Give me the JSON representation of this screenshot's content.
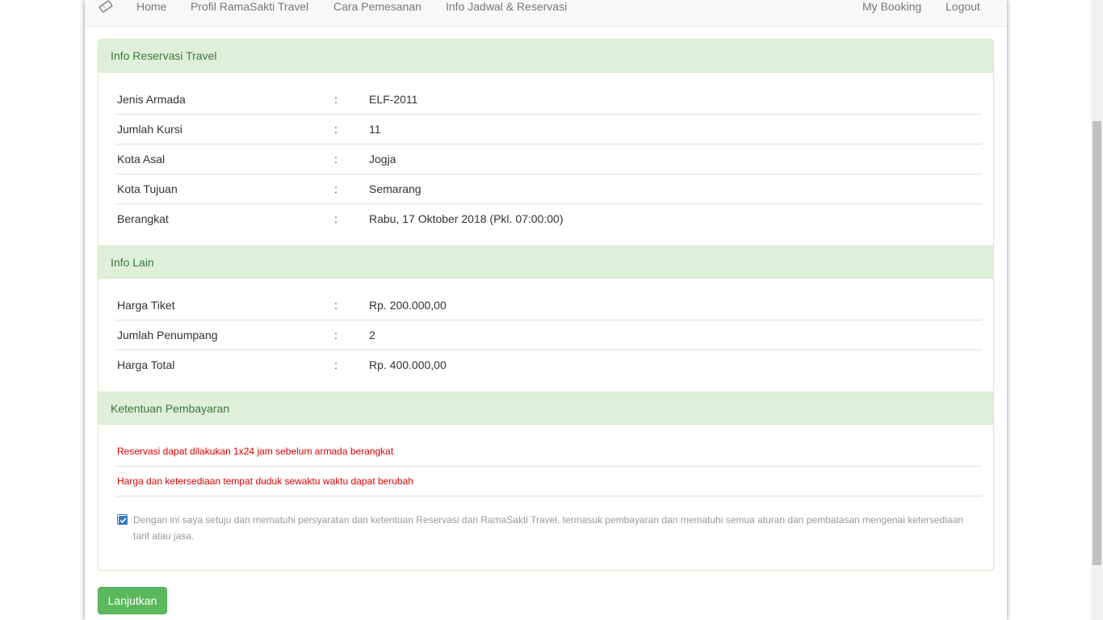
{
  "navbar": {
    "brand_icon": "ticket-icon",
    "links": {
      "home": "Home",
      "profil": "Profil RamaSakti Travel",
      "cara": "Cara Pemesanan",
      "jadwal": "Info Jadwal & Reservasi",
      "booking": "My Booking",
      "logout": "Logout"
    }
  },
  "reservasi": {
    "heading": "Info Reservasi Travel",
    "rows": [
      {
        "label": "Jenis Armada",
        "colon": ":",
        "value": "ELF-2011"
      },
      {
        "label": "Jumlah Kursi",
        "colon": ":",
        "value": "11"
      },
      {
        "label": "Kota Asal",
        "colon": ":",
        "value": "Jogja"
      },
      {
        "label": "Kota Tujuan",
        "colon": ":",
        "value": "Semarang"
      },
      {
        "label": "Berangkat",
        "colon": ":",
        "value": "Rabu, 17 Oktober 2018 (Pkl. 07:00:00)"
      }
    ]
  },
  "info_lain": {
    "heading": "Info Lain",
    "rows": [
      {
        "label": "Harga Tiket",
        "colon": ":",
        "value": "Rp. 200.000,00"
      },
      {
        "label": "Jumlah Penumpang",
        "colon": ":",
        "value": "2"
      },
      {
        "label": "Harga Total",
        "colon": ":",
        "value": "Rp. 400.000,00"
      }
    ]
  },
  "ketentuan": {
    "heading": "Ketentuan Pembayaran",
    "rules": [
      "Reservasi dapat dilakukan 1x24 jam sebelum armada berangkat",
      "Harga dan ketersediaan tempat duduk sewaktu waktu dapat berubah"
    ],
    "agreement": "Dengan ini saya setuju dan mematuhi persyaratan dan ketentuan Reservasi dari RamaSakti Travel, termasuk pembayaran dan mematuhi semua aturan dan pembatasan mengenai ketersediaan tarif atau jasa.",
    "agreement_checked": true
  },
  "button": {
    "label": "Lanjutkan"
  },
  "colors": {
    "panel_heading_bg": "#dff0d8",
    "panel_heading_text": "#3c763d",
    "rule_text": "#dd0000",
    "button_bg": "#5cb85c"
  }
}
